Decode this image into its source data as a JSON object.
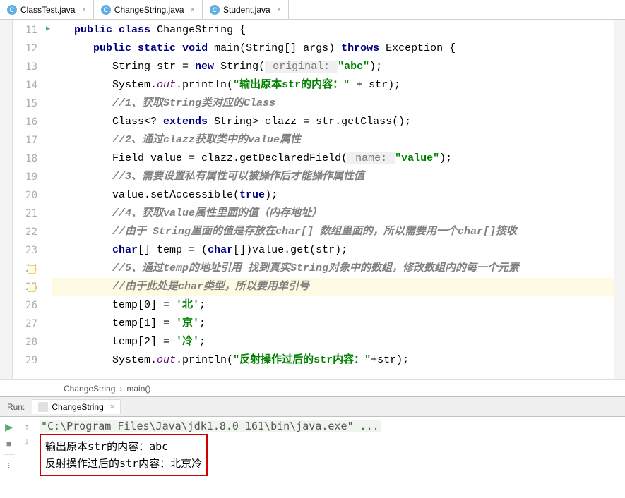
{
  "tabs": [
    {
      "label": "ClassTest.java",
      "active": false
    },
    {
      "label": "ChangeString.java",
      "active": true
    },
    {
      "label": "Student.java",
      "active": false
    }
  ],
  "gutter_start": 11,
  "code_lines": {
    "l11": {
      "indent": "   ",
      "tokens": [
        {
          "t": "public",
          "c": "kw"
        },
        {
          "t": " "
        },
        {
          "t": "class",
          "c": "kw"
        },
        {
          "t": " ChangeString {"
        }
      ]
    },
    "l12": {
      "indent": "      ",
      "tokens": [
        {
          "t": "public",
          "c": "kw"
        },
        {
          "t": " "
        },
        {
          "t": "static",
          "c": "kw"
        },
        {
          "t": " "
        },
        {
          "t": "void",
          "c": "kw"
        },
        {
          "t": " main(String[] args) "
        },
        {
          "t": "throws",
          "c": "kw"
        },
        {
          "t": " Exception {"
        }
      ]
    },
    "l13": {
      "indent": "         ",
      "tokens": [
        {
          "t": "String str = "
        },
        {
          "t": "new",
          "c": "kw"
        },
        {
          "t": " String("
        },
        {
          "t": " original: ",
          "c": "hint"
        },
        {
          "t": "\"abc\"",
          "c": "str"
        },
        {
          "t": ");"
        }
      ]
    },
    "l14": {
      "indent": "         ",
      "tokens": [
        {
          "t": "System."
        },
        {
          "t": "out",
          "c": "purple"
        },
        {
          "t": ".println("
        },
        {
          "t": "\"输出原本str的内容：\"",
          "c": "str"
        },
        {
          "t": " + str);"
        }
      ]
    },
    "l15": {
      "indent": "         ",
      "tokens": [
        {
          "t": "//1、获取String类对应的Class",
          "c": "com"
        }
      ]
    },
    "l16": {
      "indent": "         ",
      "tokens": [
        {
          "t": "Class<? "
        },
        {
          "t": "extends",
          "c": "kw"
        },
        {
          "t": " String> clazz = str.getClass();"
        }
      ]
    },
    "l17": {
      "indent": "         ",
      "tokens": [
        {
          "t": "//2、通过clazz获取类中的value属性",
          "c": "com"
        }
      ]
    },
    "l18": {
      "indent": "         ",
      "tokens": [
        {
          "t": "Field value = clazz.getDeclaredField("
        },
        {
          "t": " name: ",
          "c": "hint"
        },
        {
          "t": "\"value\"",
          "c": "str"
        },
        {
          "t": ");"
        }
      ]
    },
    "l19": {
      "indent": "         ",
      "tokens": [
        {
          "t": "//3、需要设置私有属性可以被操作后才能操作属性值",
          "c": "com"
        }
      ]
    },
    "l20": {
      "indent": "         ",
      "tokens": [
        {
          "t": "value.setAccessible("
        },
        {
          "t": "true",
          "c": "kw"
        },
        {
          "t": ");"
        }
      ]
    },
    "l21": {
      "indent": "         ",
      "tokens": [
        {
          "t": "//4、获取value属性里面的值（内存地址）",
          "c": "com"
        }
      ]
    },
    "l22": {
      "indent": "         ",
      "tokens": [
        {
          "t": "//由于 String里面的值是存放在char[] 数组里面的，所以需要用一个char[]接收",
          "c": "com"
        }
      ]
    },
    "l23": {
      "indent": "         ",
      "tokens": [
        {
          "t": "char",
          "c": "kw"
        },
        {
          "t": "[] temp = ("
        },
        {
          "t": "char",
          "c": "kw"
        },
        {
          "t": "[])value.get(str);"
        }
      ]
    },
    "l24": {
      "indent": "         ",
      "tokens": [
        {
          "t": "//5、通过temp的地址引用 找到真实String对象中的数组，修改数组内的每一个元素",
          "c": "com"
        }
      ]
    },
    "l25": {
      "indent": "         ",
      "tokens": [
        {
          "t": "//由于此处是char类型，所以要用单引号",
          "c": "com"
        }
      ],
      "hl": true
    },
    "l26": {
      "indent": "         ",
      "tokens": [
        {
          "t": "temp[0] = "
        },
        {
          "t": "'北'",
          "c": "str"
        },
        {
          "t": ";"
        }
      ]
    },
    "l27": {
      "indent": "         ",
      "tokens": [
        {
          "t": "temp[1] = "
        },
        {
          "t": "'京'",
          "c": "str"
        },
        {
          "t": ";"
        }
      ]
    },
    "l28": {
      "indent": "         ",
      "tokens": [
        {
          "t": "temp[2] = "
        },
        {
          "t": "'冷'",
          "c": "str"
        },
        {
          "t": ";"
        }
      ]
    },
    "l29": {
      "indent": "         ",
      "tokens": [
        {
          "t": "System."
        },
        {
          "t": "out",
          "c": "purple"
        },
        {
          "t": ".println("
        },
        {
          "t": "\"反射操作过后的str内容：\"",
          "c": "str"
        },
        {
          "t": "+str);"
        }
      ]
    }
  },
  "breadcrumb": {
    "class": "ChangeString",
    "method": "main()"
  },
  "run": {
    "label": "Run:",
    "tab": "ChangeString"
  },
  "console": {
    "cmd": "\"C:\\Program Files\\Java\\jdk1.8.0_161\\bin\\java.exe\" ...",
    "out1": "输出原本str的内容：abc",
    "out2": "反射操作过后的str内容：北京冷"
  }
}
